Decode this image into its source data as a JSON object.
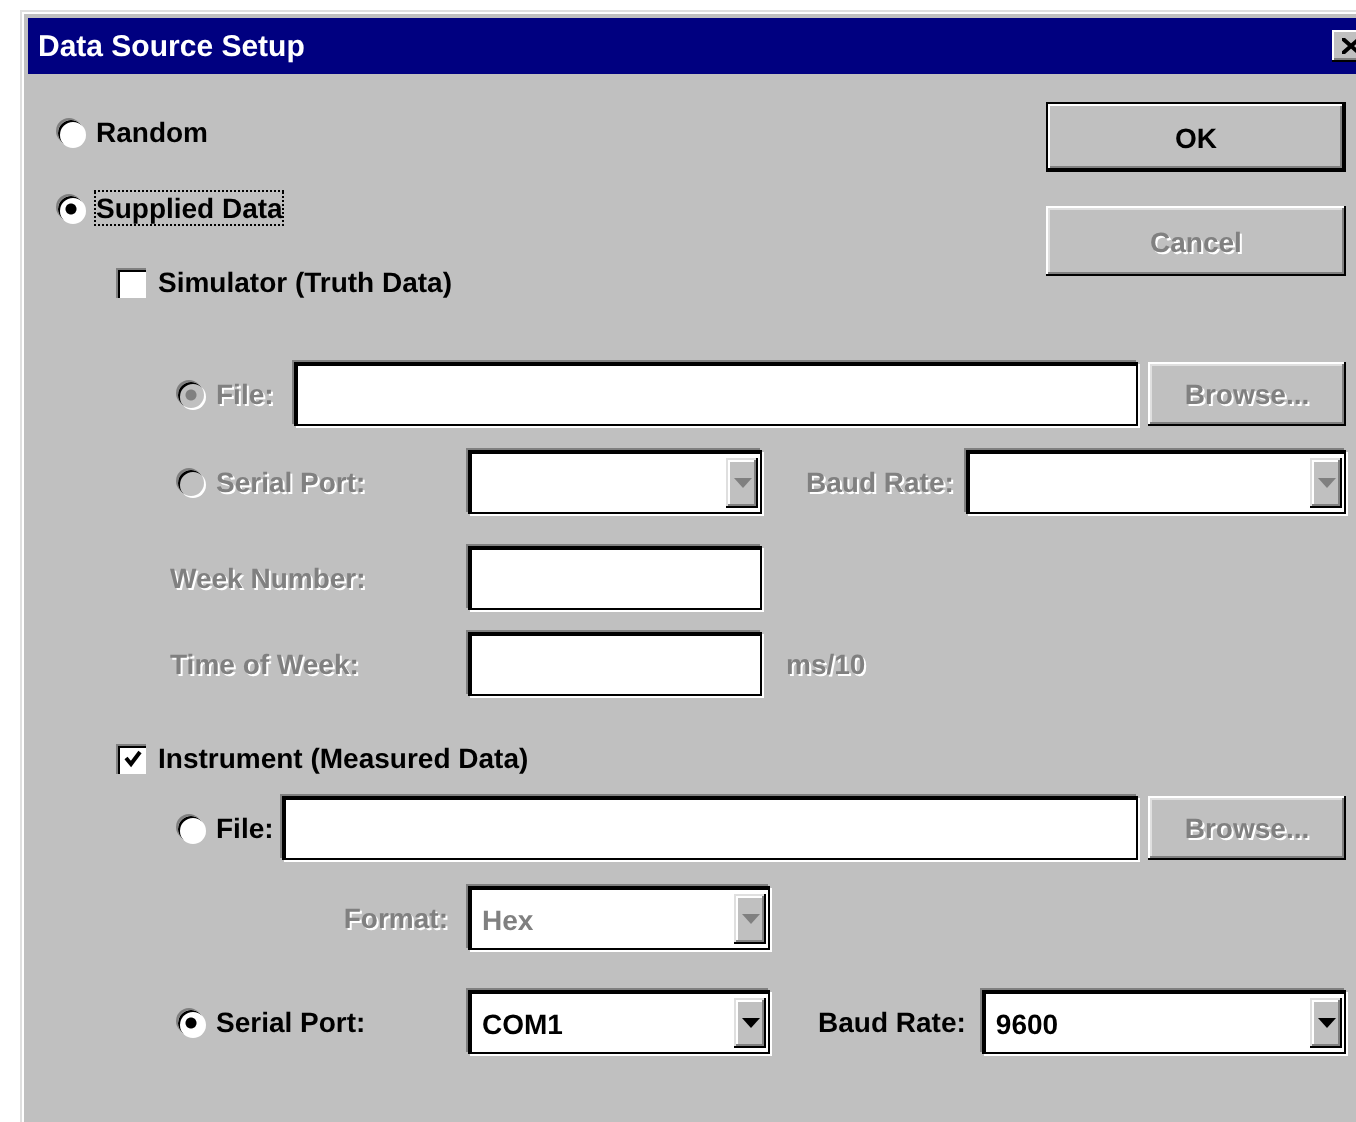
{
  "window": {
    "title": "Data Source Setup"
  },
  "source_options": [
    {
      "label": "Random",
      "selected": false
    },
    {
      "label": "Supplied Data",
      "selected": true
    }
  ],
  "buttons": [
    {
      "label": "OK",
      "disabled": false,
      "default": true
    },
    {
      "label": "Cancel",
      "disabled": true,
      "default": false
    }
  ],
  "simulator": {
    "label": "Simulator (Truth Data)",
    "checked": false,
    "file_option": {
      "label": "File:",
      "selected": true,
      "disabled": true
    },
    "browse_button": {
      "label": "Browse...",
      "disabled": true
    },
    "serial_option": {
      "label": "Serial Port:",
      "selected": false,
      "disabled": true
    },
    "baud_rate": {
      "label": "Baud Rate:",
      "disabled": true
    },
    "week_number": {
      "label": "Week Number:",
      "disabled": true
    },
    "time_of_week": {
      "label": "Time of Week:",
      "unit": "ms/10",
      "disabled": true
    }
  },
  "instrument": {
    "label": "Instrument (Measured Data)",
    "checked": true,
    "file_option": {
      "label": "File:",
      "selected": false,
      "disabled": false
    },
    "browse_button": {
      "label": "Browse...",
      "disabled": true
    },
    "format": {
      "label": "Format:",
      "value": "Hex",
      "disabled": true
    },
    "serial_option": {
      "label": "Serial Port:",
      "selected": true,
      "disabled": false
    },
    "serial_port": {
      "value": "COM1",
      "disabled": false
    },
    "baud_rate": {
      "label": "Baud Rate:",
      "value": "9600",
      "disabled": false
    }
  }
}
